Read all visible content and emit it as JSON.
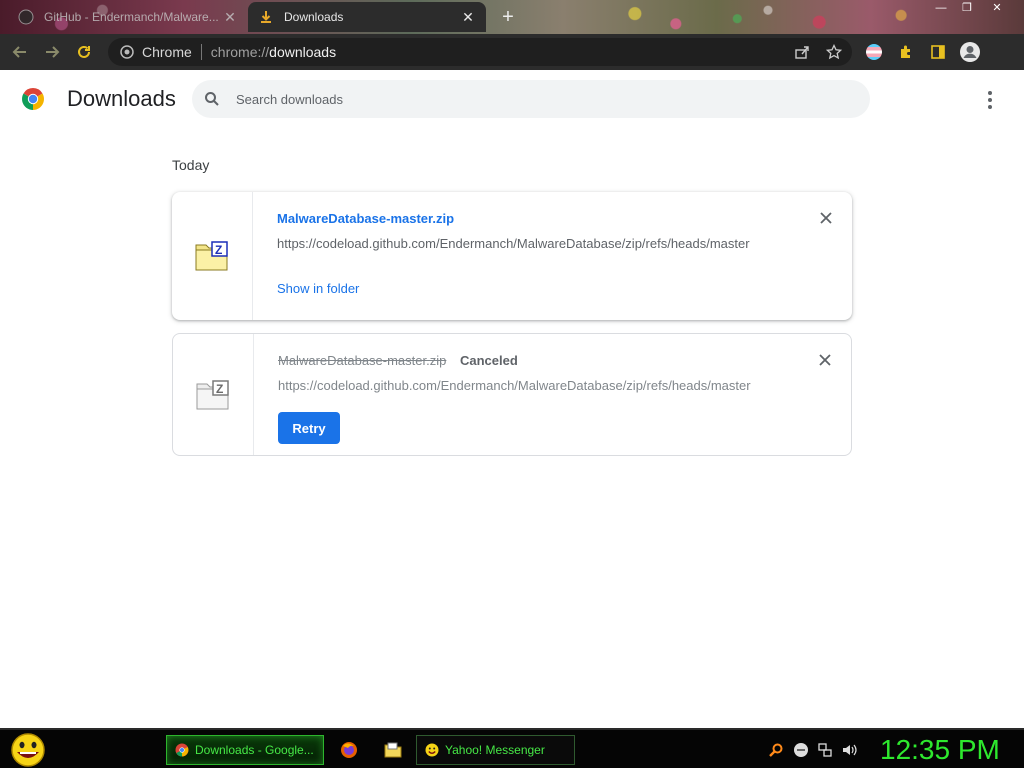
{
  "browser": {
    "tabs": [
      {
        "title": "GitHub - Endermanch/Malware...",
        "active": false
      },
      {
        "title": "Downloads",
        "active": true
      }
    ],
    "new_tab_symbol": "+",
    "omnibox": {
      "site_label": "Chrome",
      "url_scheme": "chrome://",
      "url_host": "downloads"
    },
    "toolbar_icons": [
      "back-icon",
      "forward-icon",
      "reload-icon",
      "share-icon",
      "star-icon",
      "profile-flag-icon",
      "extensions-icon",
      "sidepanel-icon",
      "account-icon"
    ]
  },
  "page": {
    "title": "Downloads",
    "search_placeholder": "Search downloads",
    "date_header": "Today"
  },
  "downloads": [
    {
      "file_name": "MalwareDatabase-master.zip",
      "url": "https://codeload.github.com/Endermanch/MalwareDatabase/zip/refs/heads/master",
      "action_label": "Show in folder",
      "status": ""
    },
    {
      "file_name": "MalwareDatabase-master.zip",
      "url": "https://codeload.github.com/Endermanch/MalwareDatabase/zip/refs/heads/master",
      "status": "Canceled",
      "action_label": "Retry"
    }
  ],
  "taskbar": {
    "tasks": [
      {
        "label": "Downloads - Google...",
        "active": true
      },
      {
        "label": "Yahoo! Messenger",
        "active": false
      }
    ],
    "clock": "12:35 PM"
  },
  "colors": {
    "link_blue": "#1a73e8",
    "taskbar_green": "#2ee82e",
    "toolbar_dark": "#2c2c2c"
  }
}
